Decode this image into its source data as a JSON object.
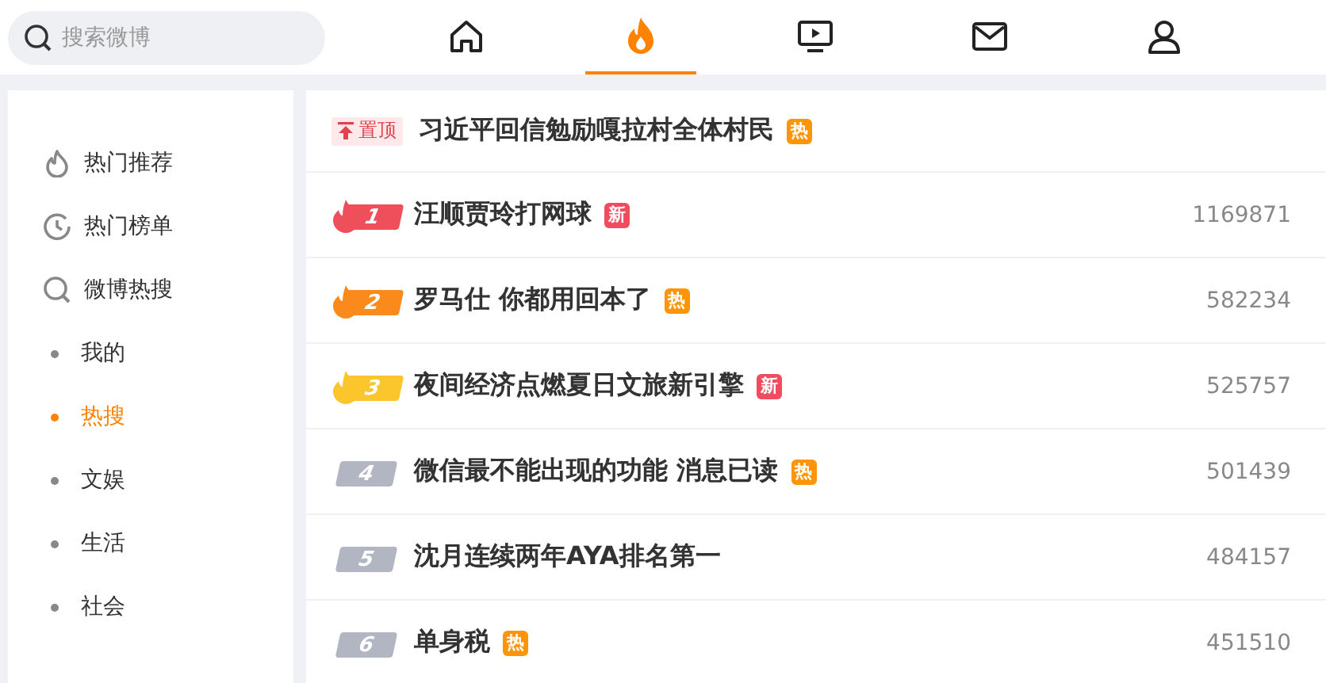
{
  "search": {
    "placeholder": "搜索微博"
  },
  "nav": [
    {
      "kind": "home",
      "selected": false
    },
    {
      "kind": "flame",
      "selected": true
    },
    {
      "kind": "video",
      "selected": false
    },
    {
      "kind": "mail",
      "selected": false
    },
    {
      "kind": "user",
      "selected": false
    }
  ],
  "sidebar": {
    "items": [
      {
        "kind": "flame",
        "label": "热门推荐",
        "selected": false
      },
      {
        "kind": "clock",
        "label": "热门榜单",
        "selected": false
      },
      {
        "kind": "search",
        "label": "微博热搜",
        "selected": false
      },
      {
        "kind": "dot",
        "label": "我的",
        "selected": false
      },
      {
        "kind": "dot",
        "label": "热搜",
        "selected": true
      },
      {
        "kind": "dot",
        "label": "文娱",
        "selected": false
      },
      {
        "kind": "dot",
        "label": "生活",
        "selected": false
      },
      {
        "kind": "dot",
        "label": "社会",
        "selected": false
      }
    ]
  },
  "hot_list": [
    {
      "kind": "pinned",
      "tag": "置顶",
      "title": "习近平回信勉励嘎拉村全体村民",
      "badge": {
        "kind": "hot",
        "text": "热"
      }
    },
    {
      "kind": "flame",
      "rank": "1",
      "color": "#ee4f5a",
      "title": "汪顺贾玲打网球",
      "badge": {
        "kind": "new",
        "text": "新"
      },
      "count": "1169871"
    },
    {
      "kind": "flame",
      "rank": "2",
      "color": "#fa8a1c",
      "title": "罗马仕 你都用回本了",
      "badge": {
        "kind": "hot",
        "text": "热"
      },
      "count": "582234"
    },
    {
      "kind": "flame",
      "rank": "3",
      "color": "#fbc52c",
      "title": "夜间经济点燃夏日文旅新引擎",
      "badge": {
        "kind": "new",
        "text": "新"
      },
      "count": "525757"
    },
    {
      "kind": "plain",
      "rank": "4",
      "color": "#b2b6c3",
      "title": "微信最不能出现的功能 消息已读",
      "badge": {
        "kind": "hot",
        "text": "热"
      },
      "count": "501439"
    },
    {
      "kind": "plain",
      "rank": "5",
      "color": "#b2b6c3",
      "title": "沈月连续两年AYA排名第一",
      "count": "484157"
    },
    {
      "kind": "plain",
      "rank": "6",
      "color": "#b2b6c3",
      "title": "单身税",
      "badge": {
        "kind": "hot",
        "text": "热"
      },
      "count": "451510"
    }
  ]
}
